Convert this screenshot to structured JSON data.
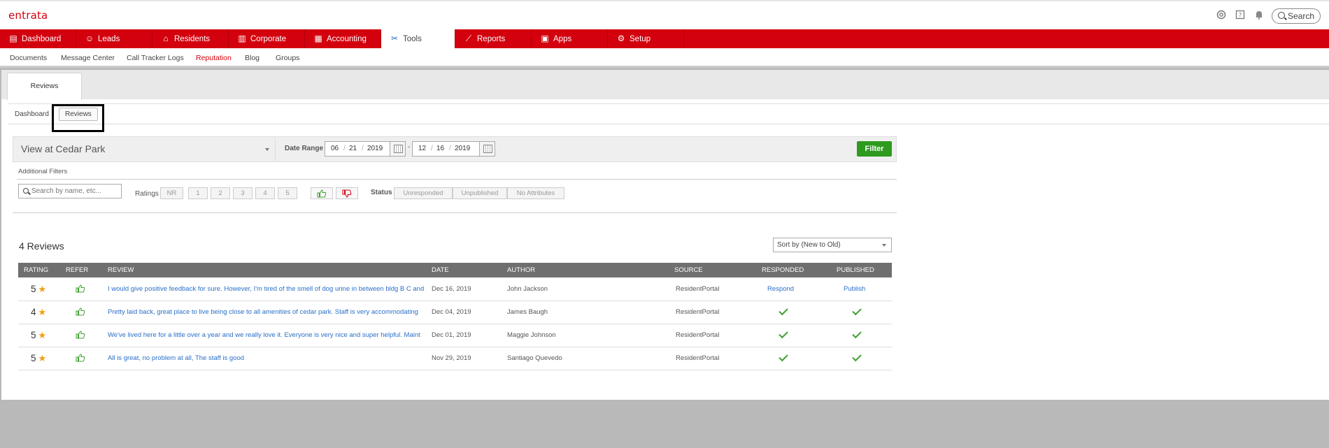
{
  "app": {
    "logo": "entrata",
    "search_label": "Search"
  },
  "header_icons": [
    "help-circle-icon",
    "question-icon",
    "bell-icon"
  ],
  "main_nav": [
    {
      "label": "Dashboard",
      "icon": "dashboard-icon",
      "glyph": "▤"
    },
    {
      "label": "Leads",
      "icon": "people-icon",
      "glyph": "☺"
    },
    {
      "label": "Residents",
      "icon": "home-icon",
      "glyph": "⌂"
    },
    {
      "label": "Corporate",
      "icon": "building-icon",
      "glyph": "▥"
    },
    {
      "label": "Accounting",
      "icon": "ledger-icon",
      "glyph": "▦"
    },
    {
      "label": "Tools",
      "icon": "tools-icon",
      "glyph": "✂"
    },
    {
      "label": "Reports",
      "icon": "chart-line-icon",
      "glyph": "⟋"
    },
    {
      "label": "Apps",
      "icon": "grid-icon",
      "glyph": "▣"
    },
    {
      "label": "Setup",
      "icon": "gear-icon",
      "glyph": "⚙"
    }
  ],
  "sub_nav": [
    "Documents",
    "Message Center",
    "Call Tracker Logs",
    "Reputation",
    "Blog",
    "Groups"
  ],
  "page_tab": "Reviews",
  "inner_tabs": [
    "Dashboard",
    "Reviews"
  ],
  "filters": {
    "property": "View at Cedar Park",
    "date_range_label": "Date Range",
    "start": {
      "mm": "06",
      "dd": "21",
      "yyyy": "2019"
    },
    "end": {
      "mm": "12",
      "dd": "16",
      "yyyy": "2019"
    },
    "separator": "/",
    "range_dash": "-",
    "filter_button": "Filter",
    "additional_label": "Additional Filters",
    "search_placeholder": "Search by name, etc...",
    "ratings_label": "Ratings",
    "ratings": [
      "NR",
      "1",
      "2",
      "3",
      "4",
      "5"
    ],
    "status_label": "Status",
    "statuses": [
      "Unresponded",
      "Unpublished",
      "No Attributes"
    ]
  },
  "results": {
    "count_label": "4 Reviews",
    "sort": "Sort by (New to Old)"
  },
  "table": {
    "headers": [
      "RATING",
      "REFER",
      "REVIEW",
      "DATE",
      "AUTHOR",
      "SOURCE",
      "RESPONDED",
      "PUBLISHED"
    ],
    "rows": [
      {
        "rating": "5",
        "review": "I would give positive feedback for sure. However, I'm tired of the smell of dog urine in between bldg B C and",
        "date": "Dec 16, 2019",
        "author": "John Jackson",
        "source": "ResidentPortal",
        "responded": "Respond",
        "published": "Publish"
      },
      {
        "rating": "4",
        "review": "Pretty laid back, great place to live being close to all amenities of cedar park. Staff is very accommodating",
        "date": "Dec 04, 2019",
        "author": "James Baugh",
        "source": "ResidentPortal",
        "responded": "",
        "published": ""
      },
      {
        "rating": "5",
        "review": "We've lived here for a little over a year and we really love it. Everyone is very nice and super helpful. Maint",
        "date": "Dec 01, 2019",
        "author": "Maggie Johnson",
        "source": "ResidentPortal",
        "responded": "",
        "published": ""
      },
      {
        "rating": "5",
        "review": "All is great, no problem at all, The staff is good",
        "date": "Nov 29, 2019",
        "author": "Santiago Quevedo",
        "source": "ResidentPortal",
        "responded": "",
        "published": ""
      }
    ]
  },
  "colors": {
    "brand_red": "#d3000e",
    "filter_green": "#2e9a1e",
    "link_blue": "#2a6fc9",
    "star": "#f29d0e",
    "check": "#3f9f2f"
  }
}
